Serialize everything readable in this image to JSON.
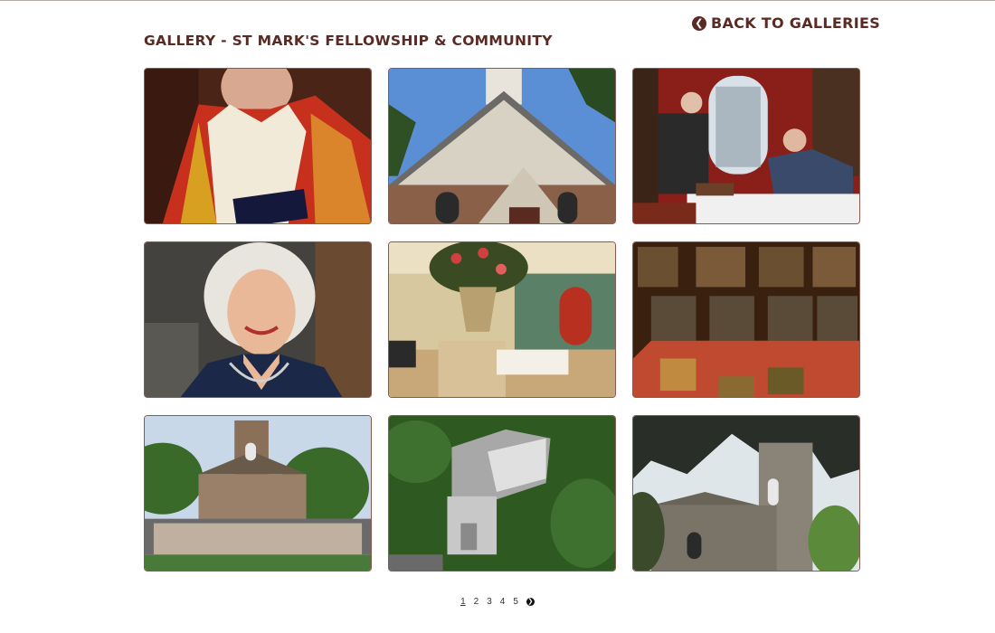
{
  "header": {
    "back_label": "BACK TO GALLERIES",
    "title": "GALLERY - ST MARK'S FELLOWSHIP & COMMUNITY"
  },
  "gallery": {
    "items": [
      {
        "subject": "clergy in red vestments"
      },
      {
        "subject": "church roof gable and bell tower"
      },
      {
        "subject": "two men examining old books"
      },
      {
        "subject": "smiling woman portrait"
      },
      {
        "subject": "hall with flowers and reception table"
      },
      {
        "subject": "library bookshelves and table"
      },
      {
        "subject": "congregation in front of stone church"
      },
      {
        "subject": "aerial view of church"
      },
      {
        "subject": "stone church tower under trees"
      }
    ]
  },
  "pagination": {
    "pages": [
      "1",
      "2",
      "3",
      "4",
      "5"
    ],
    "current": "1",
    "next_icon": "chevron-right-circle"
  },
  "colors": {
    "brand": "#5a2a24",
    "border": "#8a5a52"
  }
}
